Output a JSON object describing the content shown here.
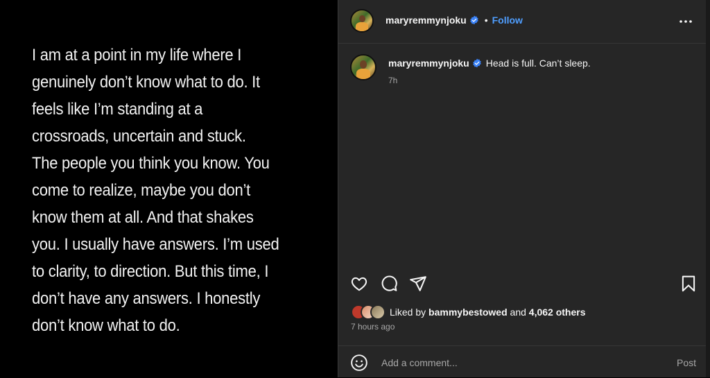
{
  "image": {
    "quote_text": "I am at a point in my life where I\ngenuinely don’t know what to do. It\nfeels like I’m standing at a\ncrossroads, uncertain and stuck.\nThe people you think you know. You\ncome to realize, maybe you don’t\nknow them at all. And that shakes\nyou. I usually have answers. I’m used\nto clarity, to direction. But this time, I\ndon’t have any answers. I honestly\ndon’t know what to do."
  },
  "header": {
    "username": "maryremmynjoku",
    "separator": "•",
    "follow_label": "Follow",
    "avatar_icon": "profile-avatar",
    "verified_icon": "verified-badge-icon",
    "more_icon": "more-options-icon"
  },
  "caption": {
    "username": "maryremmynjoku",
    "text": "Head is full. Can’t sleep.",
    "time": "7h"
  },
  "actions": {
    "like_icon": "heart-icon",
    "comment_icon": "comment-icon",
    "share_icon": "share-icon",
    "save_icon": "bookmark-icon"
  },
  "likes": {
    "prefix": "Liked by",
    "user": "bammybestowed",
    "conjunction": "and",
    "count": "4,062 others",
    "timestamp": "7 hours ago"
  },
  "comment": {
    "placeholder": "Add a comment...",
    "post_label": "Post",
    "emoji_icon": "emoji-icon"
  },
  "colors": {
    "panel_bg": "#262626",
    "accent_blue": "#4f9eff",
    "muted_text": "#a8a8a8",
    "verified": "#3b82f6"
  }
}
